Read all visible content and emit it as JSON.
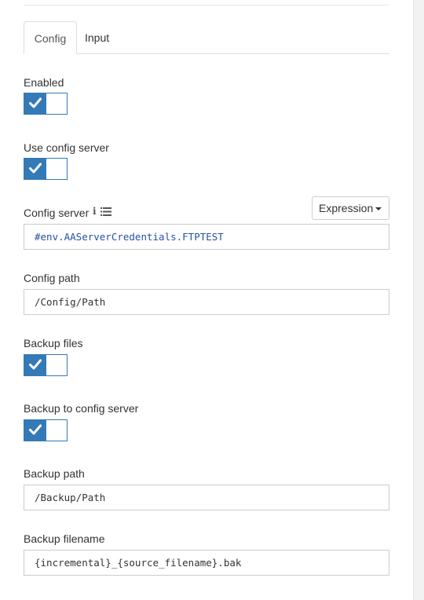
{
  "tabs": [
    {
      "label": "Config",
      "active": true
    },
    {
      "label": "Input",
      "active": false
    }
  ],
  "fields": {
    "enabled": {
      "label": "Enabled",
      "checked": true
    },
    "use_config_server": {
      "label": "Use config server",
      "checked": true
    },
    "config_server": {
      "label": "Config server",
      "value": "#env.AAServerCredentials.FTPTEST",
      "mode_button": "Expression",
      "icons": [
        "info-icon",
        "list-icon"
      ]
    },
    "config_path": {
      "label": "Config path",
      "value": "/Config/Path"
    },
    "backup_files": {
      "label": "Backup files",
      "checked": true
    },
    "backup_to_config_server": {
      "label": "Backup to config server",
      "checked": true
    },
    "backup_path": {
      "label": "Backup path",
      "value": "/Backup/Path"
    },
    "backup_filename": {
      "label": "Backup filename",
      "value": "{incremental}_{source_filename}.bak"
    }
  },
  "colors": {
    "toggle_on": "#337ab7",
    "expression_text": "#2450a8",
    "border": "#cccccc"
  }
}
